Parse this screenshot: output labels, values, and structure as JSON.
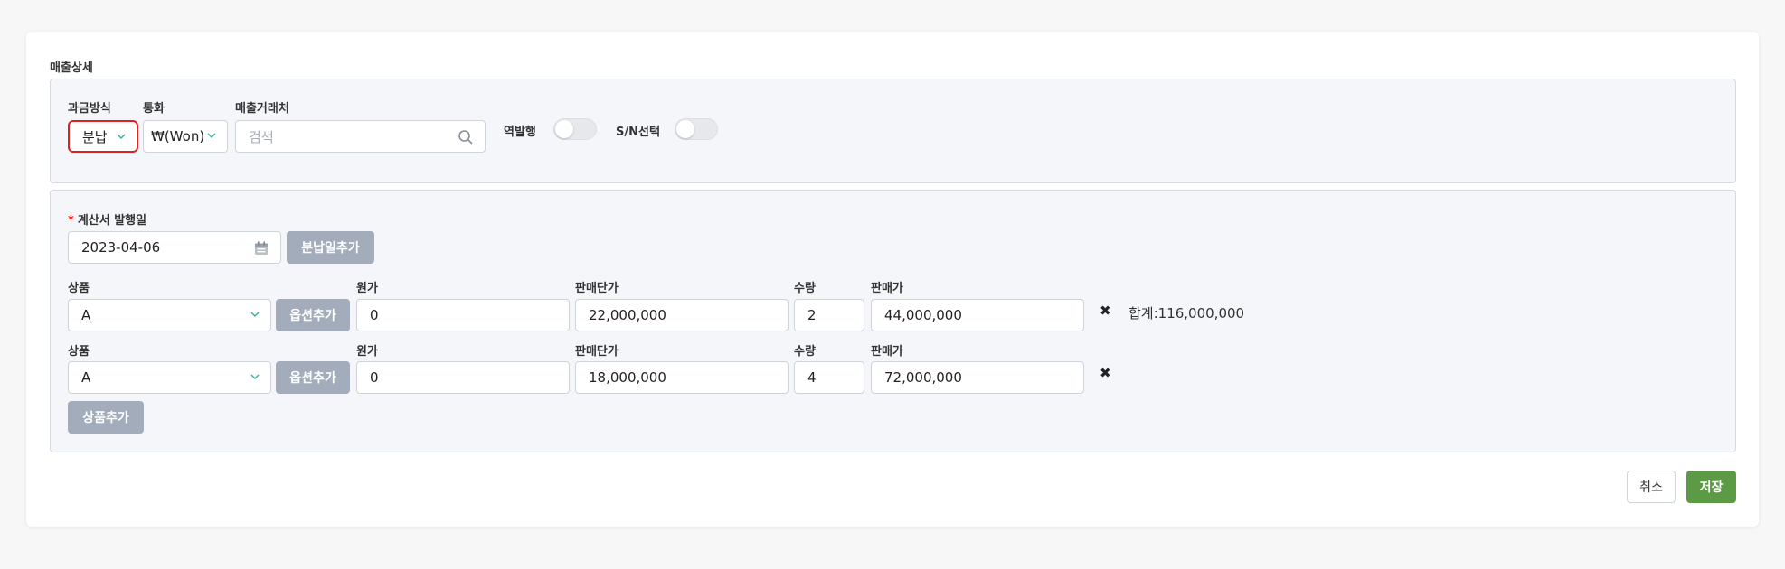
{
  "section_title": "매출상세",
  "billing": {
    "method_label": "과금방식",
    "method_value": "분납",
    "currency_label": "통화",
    "currency_value": "₩(Won)",
    "customer_label": "매출거래처",
    "customer_placeholder": "검색",
    "reverse_issue_label": "역발행",
    "reverse_issue_on": false,
    "sn_select_label": "S/N선택",
    "sn_select_on": false
  },
  "invoice": {
    "required_mark": "*",
    "date_label": "계산서 발행일",
    "date_value": "2023-04-06",
    "add_installment_label": "분납일추가"
  },
  "products": [
    {
      "product_label": "상품",
      "product_value": "A",
      "add_option_label": "옵션추가",
      "cost_label": "원가",
      "cost_value": "0",
      "unit_price_label": "판매단가",
      "unit_price_value": "22,000,000",
      "qty_label": "수량",
      "qty_value": "2",
      "sale_price_label": "판매가",
      "sale_price_value": "44,000,000",
      "remove_icon": "✖"
    },
    {
      "product_label": "상품",
      "product_value": "A",
      "add_option_label": "옵션추가",
      "cost_label": "원가",
      "cost_value": "0",
      "unit_price_label": "판매단가",
      "unit_price_value": "18,000,000",
      "qty_label": "수량",
      "qty_value": "4",
      "sale_price_label": "판매가",
      "sale_price_value": "72,000,000",
      "remove_icon": "✖"
    }
  ],
  "total_text": "합계:116,000,000",
  "add_product_label": "상품추가",
  "footer": {
    "cancel_label": "취소",
    "save_label": "저장"
  },
  "colors": {
    "save_button": "#5c9a45",
    "gray_button": "#a3acbb",
    "highlight_border": "#e0201d",
    "chevron": "#3bb3a0"
  }
}
